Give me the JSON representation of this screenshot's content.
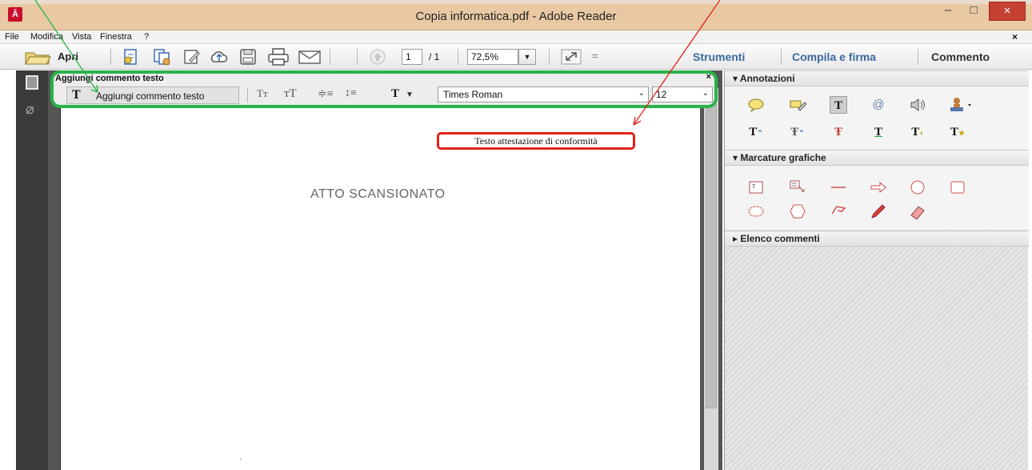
{
  "window": {
    "title": "Copia informatica.pdf - Adobe Reader",
    "app_icon_text": "Ā",
    "minimize_glyph": "–",
    "maximize_glyph": "□",
    "close_glyph": "×"
  },
  "menubar": {
    "items": [
      "File",
      "Modifica",
      "Vista",
      "Finestra",
      "?"
    ],
    "close_glyph": "×"
  },
  "toolbar": {
    "open_label": "Apri",
    "page_current": "1",
    "page_total": "/ 1",
    "zoom": "72,5%",
    "zoom_dropdown": "▼",
    "overflow": "=",
    "tools_label": "Strumenti",
    "fill_sign_label": "Compila e firma",
    "comment_label": "Commento"
  },
  "comment_toolbar": {
    "title": "Aggiungi commento testo",
    "close_glyph": "×",
    "active_tool_glyph": "T",
    "active_tool_label": "Aggiungi commento testo",
    "font_name": "Times Roman",
    "font_size": "12",
    "dropdown_glyph": "⌄"
  },
  "document": {
    "annotation_text": "Testo attestazione di conformità",
    "body_text": "ATTO SCANSIONATO"
  },
  "right_panel": {
    "annotations_header": "▾ Annotazioni",
    "markup_header": "▾ Marcature grafiche",
    "comments_list_header": "▸ Elenco commenti"
  },
  "colors": {
    "green_highlight": "#29b34a",
    "red_highlight": "#e2231a",
    "link_blue": "#3a6aa1"
  }
}
